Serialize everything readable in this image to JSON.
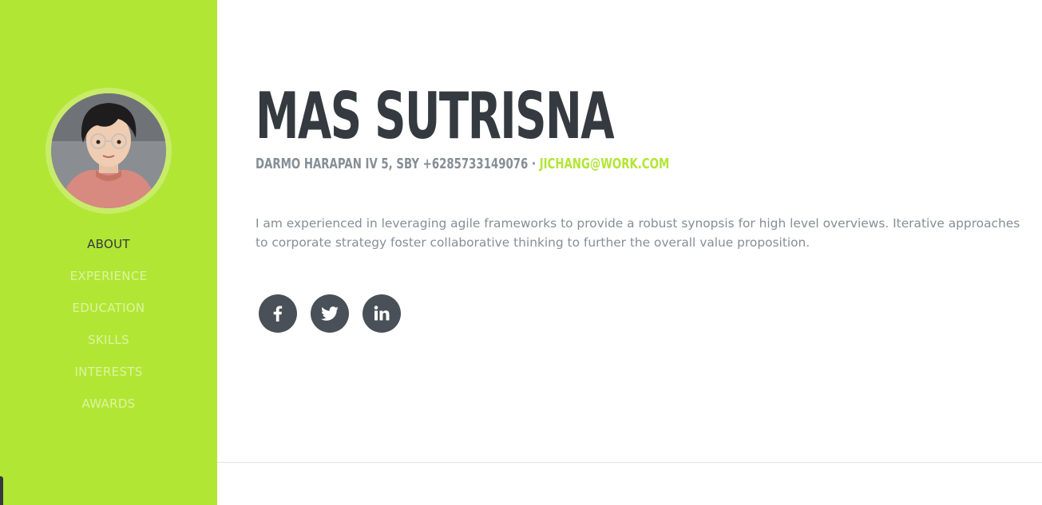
{
  "profile": {
    "name": "MAS SUTRISNA",
    "address": "DARMO HARAPAN IV 5, SBY +6285733149076 · ",
    "email": "JICHANG@WORK.COM",
    "bio": "I am experienced in leveraging agile frameworks to provide a robust synopsis for high level overviews. Iterative approaches to corporate strategy foster collaborative thinking to further the overall value proposition."
  },
  "nav": {
    "items": [
      {
        "label": "ABOUT",
        "active": true
      },
      {
        "label": "EXPERIENCE",
        "active": false
      },
      {
        "label": "EDUCATION",
        "active": false
      },
      {
        "label": "SKILLS",
        "active": false
      },
      {
        "label": "INTERESTS",
        "active": false
      },
      {
        "label": "AWARDS",
        "active": false
      }
    ]
  },
  "social": {
    "icons": [
      "facebook-icon",
      "twitter-icon",
      "linkedin-icon"
    ]
  },
  "colors": {
    "sidebar": "#b2e634",
    "accent": "#b2e634",
    "heading": "#343a40",
    "muted": "#868e96",
    "social_bg": "#495057"
  }
}
